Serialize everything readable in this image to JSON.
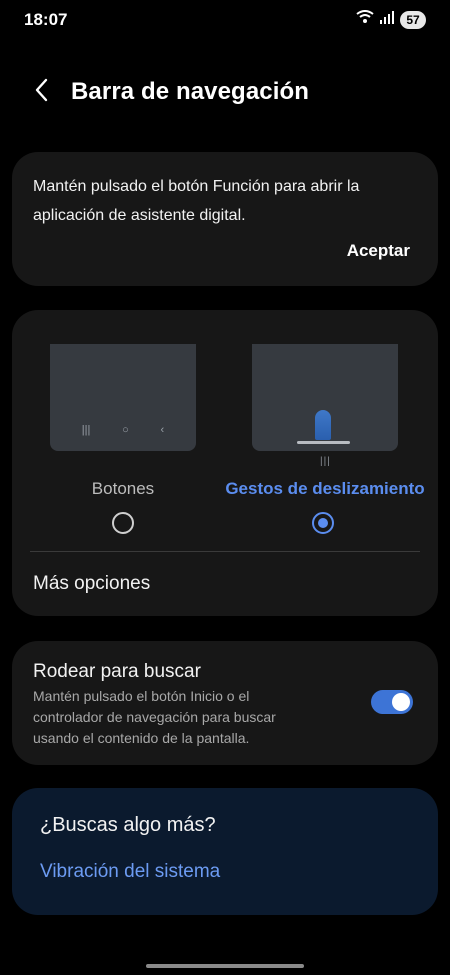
{
  "status_bar": {
    "time": "18:07",
    "battery": "57"
  },
  "header": {
    "title": "Barra de navegación"
  },
  "assistant_card": {
    "text": "Mantén pulsado el botón Función para abrir la aplicación de asistente digital.",
    "accept_label": "Aceptar"
  },
  "navigation_type": {
    "options": [
      {
        "label": "Botones",
        "selected": false
      },
      {
        "label": "Gestos de deslizamiento",
        "selected": true
      }
    ],
    "more_options_label": "Más opciones"
  },
  "circle_to_search": {
    "title": "Rodear para buscar",
    "description": "Mantén pulsado el botón Inicio o el controlador de navegación para buscar usando el contenido de la pantalla.",
    "enabled": true
  },
  "looking_for_more": {
    "title": "¿Buscas algo más?",
    "link_label": "Vibración del sistema"
  },
  "colors": {
    "accent": "#5b8def",
    "card": "#171717",
    "suggest_card": "#0b1a2e"
  },
  "icons": [
    "wifi-icon",
    "signal-icon",
    "back-arrow-icon",
    "recents-icon",
    "home-icon",
    "back-icon"
  ]
}
